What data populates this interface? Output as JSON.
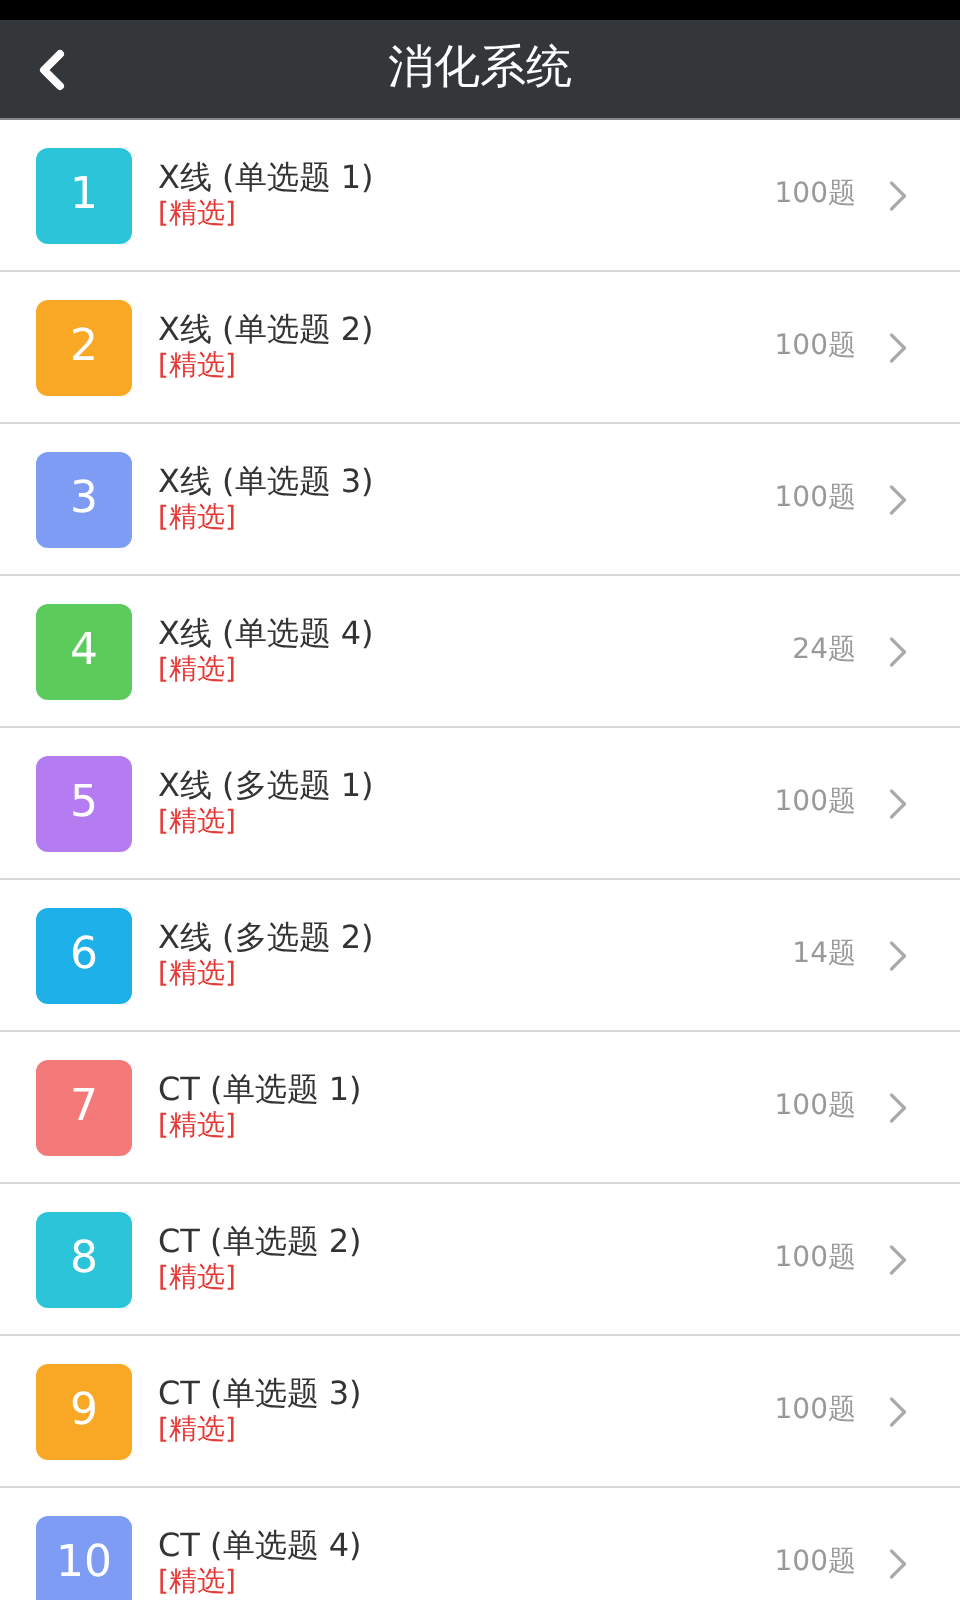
{
  "header": {
    "title": "消化系统"
  },
  "items": [
    {
      "number": "1",
      "title": "X线 (单选题 1)",
      "tag": "[精选]",
      "count": "100题",
      "color": "#2bc4d8"
    },
    {
      "number": "2",
      "title": "X线 (单选题 2)",
      "tag": "[精选]",
      "count": "100题",
      "color": "#f9a825"
    },
    {
      "number": "3",
      "title": "X线 (单选题 3)",
      "tag": "[精选]",
      "count": "100题",
      "color": "#7f9cf5"
    },
    {
      "number": "4",
      "title": "X线 (单选题 4)",
      "tag": "[精选]",
      "count": "24题",
      "color": "#5bcb5b"
    },
    {
      "number": "5",
      "title": "X线 (多选题 1)",
      "tag": "[精选]",
      "count": "100题",
      "color": "#b57bf0"
    },
    {
      "number": "6",
      "title": "X线 (多选题 2)",
      "tag": "[精选]",
      "count": "14题",
      "color": "#1eb0e8"
    },
    {
      "number": "7",
      "title": "CT (单选题 1)",
      "tag": "[精选]",
      "count": "100题",
      "color": "#f47a7a"
    },
    {
      "number": "8",
      "title": "CT (单选题 2)",
      "tag": "[精选]",
      "count": "100题",
      "color": "#2bc4d8"
    },
    {
      "number": "9",
      "title": "CT (单选题 3)",
      "tag": "[精选]",
      "count": "100题",
      "color": "#f9a825"
    },
    {
      "number": "10",
      "title": "CT (单选题 4)",
      "tag": "[精选]",
      "count": "100题",
      "color": "#7f9cf5"
    }
  ]
}
